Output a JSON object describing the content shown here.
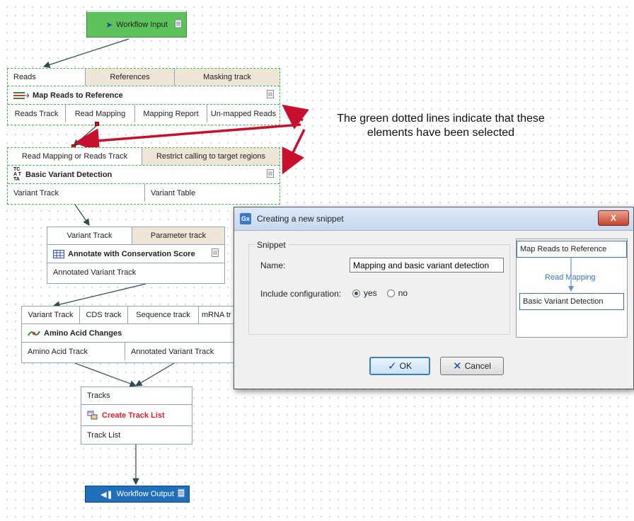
{
  "workflow_input": {
    "label": "Workflow Input"
  },
  "map_reads": {
    "inputs": [
      "Reads",
      "References",
      "Masking track"
    ],
    "title": "Map Reads to Reference",
    "outputs": [
      "Reads Track",
      "Read Mapping",
      "Mapping Report",
      "Un-mapped Reads"
    ]
  },
  "basic_variant": {
    "inputs": [
      "Read Mapping or Reads Track",
      "Restrict calling to target regions"
    ],
    "title": "Basic Variant Detection",
    "title_icon_text": "TCA TTA",
    "outputs": [
      "Variant Track",
      "Variant Table"
    ]
  },
  "conservation": {
    "inputs": [
      "Variant Track",
      "Parameter track"
    ],
    "title": "Annotate with Conservation Score",
    "outputs": [
      "Annotated Variant Track"
    ]
  },
  "amino": {
    "inputs": [
      "Variant Track",
      "CDS track",
      "Sequence track",
      "mRNA tr"
    ],
    "title": "Amino Acid Changes",
    "outputs": [
      "Amino Acid Track",
      "Annotated Variant Track"
    ]
  },
  "track_list": {
    "input": "Tracks",
    "title": "Create Track List",
    "output": "Track List"
  },
  "workflow_output": {
    "label": "Workflow Output"
  },
  "annotation": {
    "line1": "The green dotted lines indicate that these",
    "line2": "elements have been selected"
  },
  "dialog": {
    "icon_text": "Gx",
    "title": "Creating a new snippet",
    "close_label": "X",
    "group_title": "Snippet",
    "name_label": "Name:",
    "name_value": "Mapping and basic variant detection",
    "config_label": "Include configuration:",
    "yes_label": "yes",
    "no_label": "no",
    "ok_label": "OK",
    "cancel_label": "Cancel",
    "preview": {
      "top": "Map Reads to Reference",
      "edge": "Read Mapping",
      "bottom": "Basic Variant Detection"
    }
  },
  "colors": {
    "input_green": "#5cc35c",
    "output_blue": "#1f6fba",
    "annotation_red": "#c8102e",
    "selection_green": "#3bb54a",
    "title_red": "#e0202a"
  }
}
